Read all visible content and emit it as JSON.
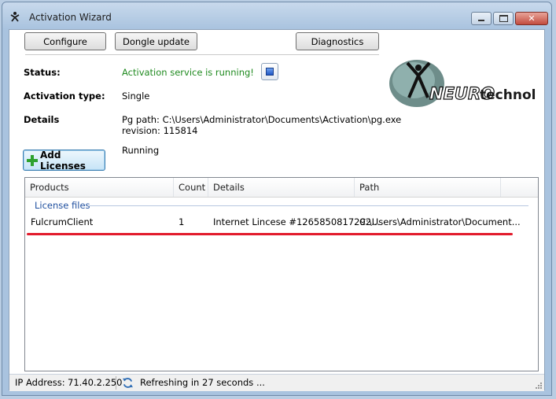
{
  "window": {
    "title": "Activation Wizard"
  },
  "toolbar": {
    "configure_label": "Configure",
    "dongle_label": "Dongle update",
    "diagnostics_label": "Diagnostics"
  },
  "status": {
    "status_label": "Status:",
    "status_value": "Activation service is running!",
    "type_label": "Activation type:",
    "type_value": "Single",
    "details_label": "Details",
    "details_line1": "Pg path: C:\\Users\\Administrator\\Documents\\Activation\\pg.exe",
    "details_line2": "revision: 115814",
    "details_line3": "Running"
  },
  "logo": {
    "text_neuro": "NEURO",
    "text_tech": "technology"
  },
  "add_licenses_label": "Add Licenses",
  "table": {
    "columns": [
      "Products",
      "Count",
      "Details",
      "Path"
    ],
    "group_label": "License files",
    "rows": [
      {
        "product": "FulcrumClient",
        "count": "1",
        "details": "Internet Lincese #1265850817292...",
        "path": "C:\\Users\\Administrator\\Document..."
      }
    ]
  },
  "statusbar": {
    "ip_label": "IP Address:",
    "ip_value": "71.40.2.250",
    "refresh_text": "Refreshing in 27 seconds ..."
  },
  "colors": {
    "status_green": "#1f8a1f",
    "group_blue": "#1e4e9e",
    "underline_red": "#e21b2c",
    "plus_green": "#2ea12e"
  },
  "icons": {
    "app": "wizard-icon",
    "stop": "stop-icon",
    "add": "plus-icon",
    "refresh": "refresh-icon"
  }
}
